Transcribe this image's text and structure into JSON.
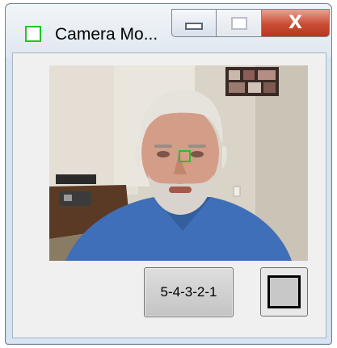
{
  "window": {
    "title": "Camera Mo...",
    "icon": "green-square-icon",
    "accent_color": "#22c422"
  },
  "caption_buttons": {
    "minimize_icon": "minimize-icon",
    "maximize_icon": "maximize-icon",
    "close_label": "X"
  },
  "main": {
    "camera_feed_icon": "camera-feed",
    "countdown_label": "5-4-3-2-1",
    "toggle_icon": "square-toggle-icon"
  }
}
